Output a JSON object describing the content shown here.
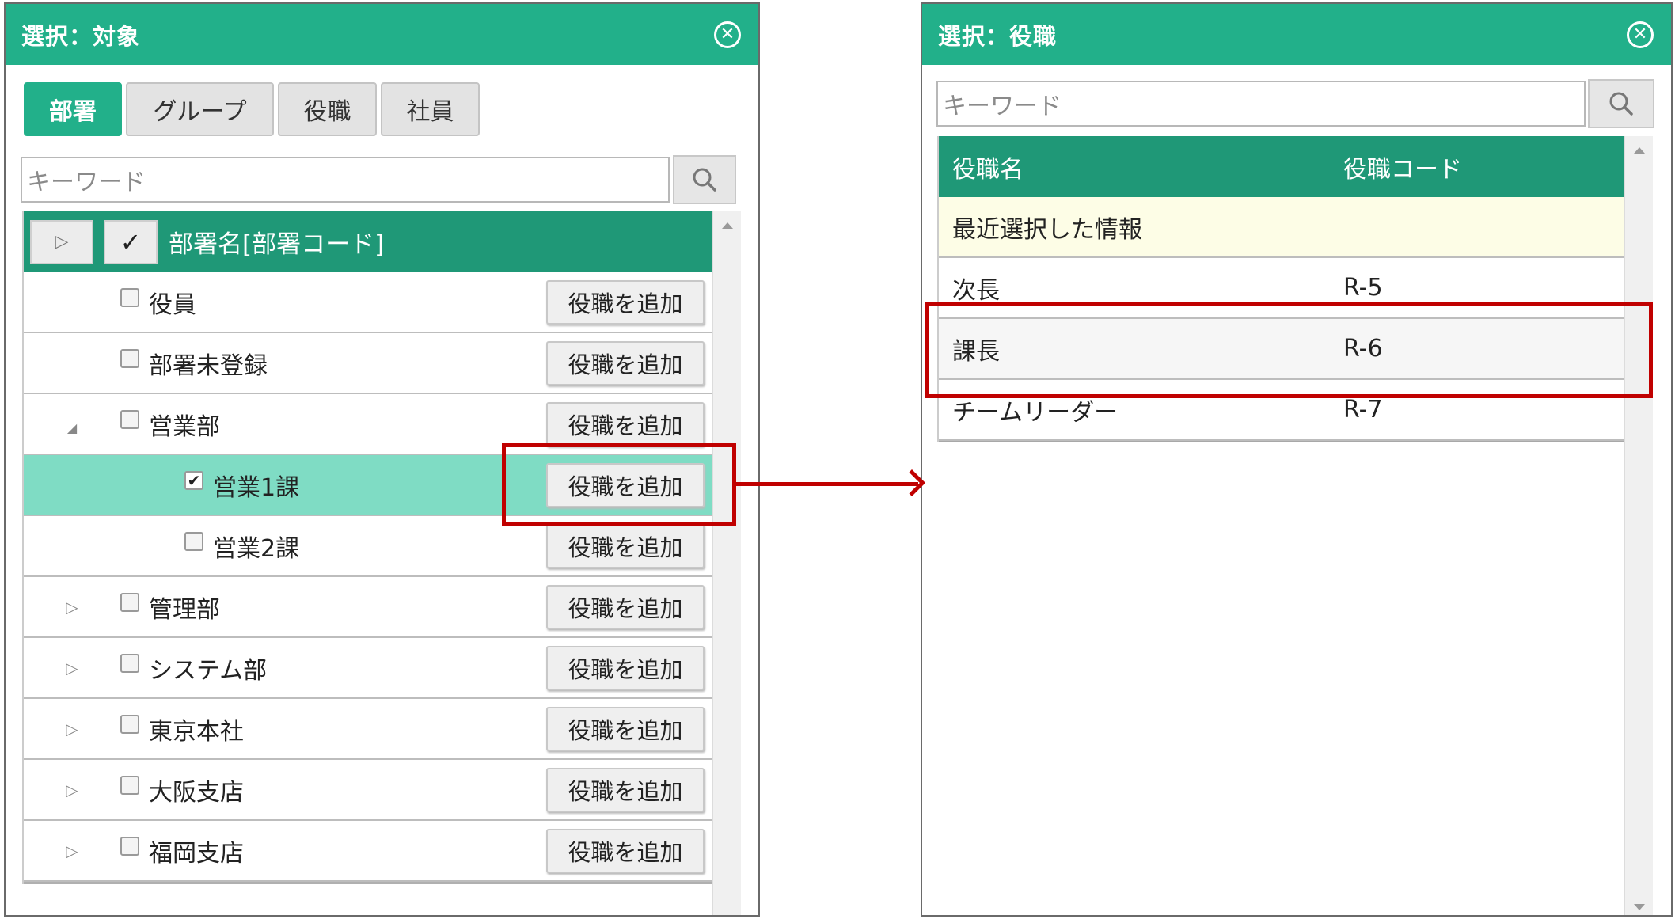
{
  "left_dialog": {
    "title": "選択：対象",
    "close_icon": "close-circle-icon",
    "tabs": [
      {
        "label": "部署",
        "active": true
      },
      {
        "label": "グループ",
        "active": false
      },
      {
        "label": "役職",
        "active": false
      },
      {
        "label": "社員",
        "active": false
      }
    ],
    "search": {
      "placeholder": "キーワード",
      "icon": "search-icon"
    },
    "tree_header": {
      "check_mark": "✓",
      "label": "部署名[部署コード]"
    },
    "rows": [
      {
        "label": "役員",
        "button": "役職を追加",
        "checked": false
      },
      {
        "label": "部署未登録",
        "button": "役職を追加",
        "checked": false
      },
      {
        "label": "営業部",
        "button": "役職を追加",
        "checked": false,
        "expanded": true
      },
      {
        "label": "営業1課",
        "button": "役職を追加",
        "checked": true,
        "selected": true
      },
      {
        "label": "営業2課",
        "button": "役職を追加",
        "checked": false
      },
      {
        "label": "管理部",
        "button": "役職を追加",
        "checked": false
      },
      {
        "label": "システム部",
        "button": "役職を追加",
        "checked": false
      },
      {
        "label": "東京本社",
        "button": "役職を追加",
        "checked": false
      },
      {
        "label": "大阪支店",
        "button": "役職を追加",
        "checked": false
      },
      {
        "label": "福岡支店",
        "button": "役職を追加",
        "checked": false
      }
    ]
  },
  "right_dialog": {
    "title": "選択：役職",
    "close_icon": "close-circle-icon",
    "search": {
      "placeholder": "キーワード",
      "icon": "search-icon"
    },
    "columns": [
      "役職名",
      "役職コード"
    ],
    "recent_label": "最近選択した情報",
    "rows": [
      {
        "name": "次長",
        "code": "R-5"
      },
      {
        "name": "課長",
        "code": "R-6"
      },
      {
        "name": "チームリーダー",
        "code": "R-7"
      }
    ]
  },
  "colors": {
    "brand": "#22b08a",
    "header": "#1f9877",
    "selected_row": "#7fdcc4",
    "highlight": "#c00000"
  }
}
